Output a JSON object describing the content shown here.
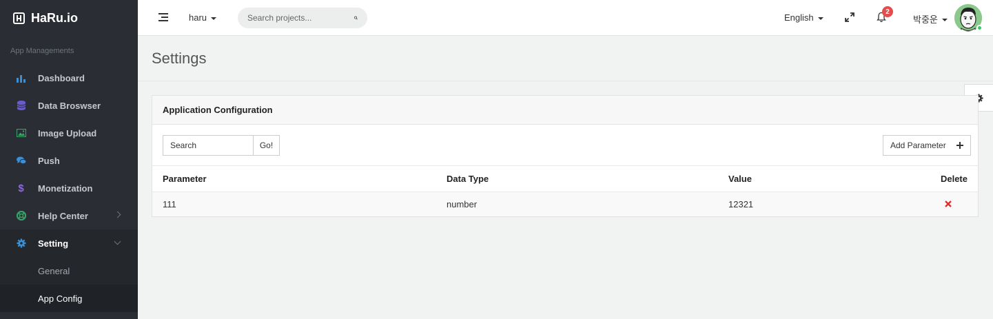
{
  "app": {
    "brand": "HaRu.io"
  },
  "sidebar": {
    "section_label": "App Managements",
    "items": [
      {
        "label": "Dashboard",
        "icon": "bar-chart-icon",
        "color": "#3b8fd6"
      },
      {
        "label": "Data Broswser",
        "icon": "database-icon",
        "color": "#6a5acd"
      },
      {
        "label": "Image Upload",
        "icon": "image-icon",
        "color": "#38a169"
      },
      {
        "label": "Push",
        "icon": "chat-bubbles-icon",
        "color": "#3b8fd6"
      },
      {
        "label": "Monetization",
        "icon": "dollar-icon",
        "color": "#8e6bd6"
      },
      {
        "label": "Help Center",
        "icon": "lifebuoy-icon",
        "color": "#38a169"
      },
      {
        "label": "Setting",
        "icon": "gear-icon",
        "color": "#3b8fd6"
      }
    ],
    "sub_items": [
      {
        "label": "General"
      },
      {
        "label": "App Config"
      }
    ]
  },
  "topbar": {
    "project": "haru",
    "search_placeholder": "Search projects...",
    "language": "English",
    "notifications_count": "2",
    "user_name": "박중운"
  },
  "page": {
    "title": "Settings"
  },
  "panel": {
    "title": "Application Configuration",
    "search_placeholder": "Search",
    "go_label": "Go!",
    "add_label": "Add Parameter",
    "columns": [
      "Parameter",
      "Data Type",
      "Value",
      "Delete"
    ],
    "rows": [
      {
        "parameter": "111",
        "data_type": "number",
        "value": "12321"
      }
    ]
  }
}
